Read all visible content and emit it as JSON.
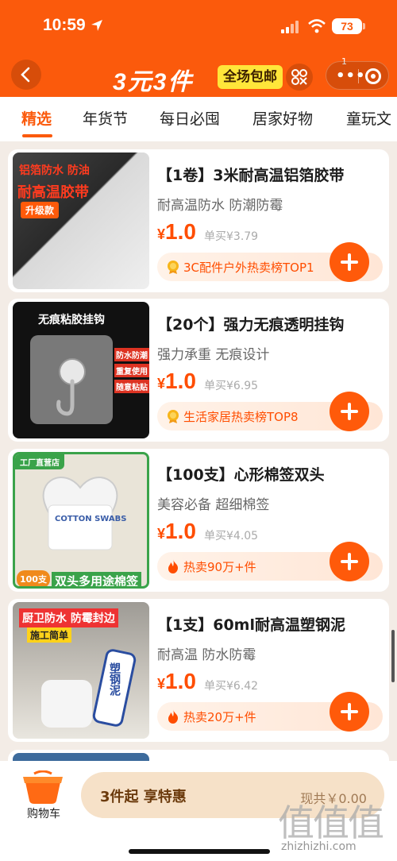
{
  "status_bar": {
    "time": "10:59",
    "battery": "73"
  },
  "header": {
    "title": "3元3件",
    "badge": "全场包邮",
    "capsule_count": "1",
    "colors": {
      "brand": "#fb5a0c",
      "badge_bg": "#ffe63a"
    }
  },
  "tabs": [
    {
      "label": "精选",
      "active": true
    },
    {
      "label": "年货节"
    },
    {
      "label": "每日必囤"
    },
    {
      "label": "居家好物"
    },
    {
      "label": "童玩文"
    }
  ],
  "products": [
    {
      "name": "【1卷】3米耐高温铝箔胶带",
      "subtitle": "耐高温防水 防潮防霉",
      "currency": "¥",
      "price": "1.0",
      "original": "单买¥3.79",
      "tag": "3C配件户外热卖榜TOP1",
      "tag_icon": "medal-icon",
      "image_text": {
        "top": "铝箔防水 防油",
        "middle": "耐高温胶带",
        "badge": "升级款"
      }
    },
    {
      "name": "【20个】强力无痕透明挂钩",
      "subtitle": "强力承重 无痕设计",
      "currency": "¥",
      "price": "1.0",
      "original": "单买¥6.95",
      "tag": "生活家居热卖榜TOP8",
      "tag_icon": "medal-icon",
      "image_text": {
        "title": "无痕粘胶挂钩",
        "labels": [
          "防水防潮",
          "重复使用",
          "随意粘贴"
        ]
      }
    },
    {
      "name": "【100支】心形棉签双头",
      "subtitle": "美容必备 超细棉签",
      "currency": "¥",
      "price": "1.0",
      "original": "单买¥4.05",
      "tag": "热卖90万+件",
      "tag_icon": "flame-icon",
      "image_text": {
        "corner": "工厂直营店",
        "label": "COTTON SWABS",
        "count": "100支",
        "banner": "双头多用途棉签"
      }
    },
    {
      "name": "【1支】60ml耐高温塑钢泥",
      "subtitle": "耐高温 防水防霉",
      "currency": "¥",
      "price": "1.0",
      "original": "单买¥6.42",
      "tag": "热卖20万+件",
      "tag_icon": "flame-icon",
      "image_text": {
        "banner": "厨卫防水 防霉封边",
        "sub": "施工简单",
        "tube": "塑钢泥"
      }
    }
  ],
  "bottom_bar": {
    "cart_label": "购物车",
    "checkout_text": "3件起 享特惠",
    "total": "现共￥0.00"
  },
  "watermark": {
    "big": "值值值",
    "small": "zhizhizhi.com"
  }
}
